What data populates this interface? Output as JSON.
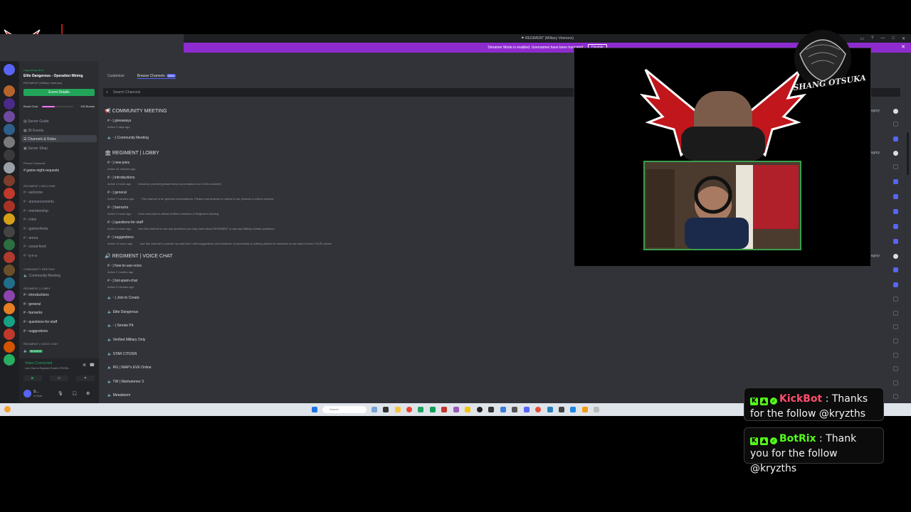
{
  "window": {
    "title": "REGIMENT (Military Veterans)",
    "notice": "Streamer Mode is enabled. Usernames have been truncated.",
    "notice_button": "Disable"
  },
  "server": {
    "happening_now": "Happening Now",
    "event_title": "Elite Dangerous - Operation Mining",
    "event_button": "Event Details",
    "boost_goal": "Boost Goal",
    "boost_count": "109 Boosts",
    "menu": [
      "Server Guide",
      "36 Events",
      "Channels & Roles",
      "Server Shop"
    ],
    "pinned_header": "Pinned Channels",
    "pinned": [
      "game-night-requests"
    ],
    "categories": [
      {
        "name": "REGIMENT | WELCOME",
        "items": [
          "welcome",
          "announcements",
          "membership",
          "roles",
          "games4vets",
          "arena",
          "social-feed",
          "q-n-a"
        ]
      },
      {
        "name": "COMMUNITY MEETING",
        "items": [
          "Community Meeting"
        ]
      },
      {
        "name": "REGIMENT | LOBBY",
        "items": [
          "introductions",
          "general",
          "barracks",
          "questions-for-staff",
          "suggestions"
        ]
      },
      {
        "name": "REGIMENT | VOICE CHAT",
        "items": []
      }
    ],
    "in_voice_label": "IN VOICE"
  },
  "voice_panel": {
    "status": "Video Connected",
    "sub": "Live Chat on Regiment Twitch | REGIM...",
    "user": "S...",
    "user_status": "In Voice"
  },
  "browse": {
    "tab_customize": "Customize",
    "tab_browse": "Browse Channels",
    "tab_new": "NEW",
    "search_placeholder": "Search Channels",
    "category_label": "Category",
    "sections": [
      {
        "name": "COMMUNITY MEETING",
        "channels": [
          {
            "name": "giveaways",
            "activity": "Active 2 days ago",
            "desc": ""
          },
          {
            "name": "Community Meeting",
            "activity": "",
            "desc": ""
          }
        ]
      },
      {
        "name": "REGIMENT | LOBBY",
        "channels": [
          {
            "name": "new-joins",
            "activity": "Active 44 minutes ago",
            "desc": ""
          },
          {
            "name": "introductions",
            "activity": "Active 4 hours ago",
            "desc": "Introduce yourself (please keep conversations out of this channel)"
          },
          {
            "name": "general",
            "activity": "Active 7 minutes ago",
            "desc": "This channel is for general conversations. Please post pictures or videos in our pictures-n-videos channel."
          },
          {
            "name": "barracks",
            "activity": "Active 2 hours ago",
            "desc": "Chat reserved for official verified members of Regiment Gaming"
          },
          {
            "name": "questions-for-staff",
            "activity": "Active 4 hours ago",
            "desc": "Use this channel to ask any questions you may have about REGIMENT or ask any Military related questions"
          },
          {
            "name": "suggestions",
            "activity": "Active 14 hours ago",
            "desc": "Use this channel to provide my staff and I with suggestions and feedback. A community is nothing without its members so we want to hear YOUR voices!"
          }
        ]
      },
      {
        "name": "REGIMENT | VOICE CHAT",
        "channels": [
          {
            "name": "how-to-use-voice",
            "activity": "Active 2 months ago",
            "desc": ""
          },
          {
            "name": "bot-spam-chat",
            "activity": "Active 3 minutes ago",
            "desc": ""
          },
          {
            "name": "Join to Create",
            "activity": "",
            "desc": ""
          },
          {
            "name": "Elite Dangerous",
            "activity": "",
            "desc": ""
          },
          {
            "name": "Smoke Pit",
            "activity": "",
            "desc": ""
          },
          {
            "name": "Verified Military Only",
            "activity": "",
            "desc": ""
          },
          {
            "name": "STAR CITIZEN",
            "activity": "",
            "desc": ""
          },
          {
            "name": "RG | INAP's EVE Online",
            "activity": "",
            "desc": ""
          },
          {
            "name": "TW | Warhammer 3",
            "activity": "",
            "desc": ""
          },
          {
            "name": "Metalstorm",
            "activity": "",
            "desc": ""
          }
        ]
      }
    ]
  },
  "taskbar": {
    "search_placeholder": "Search"
  },
  "overlay": {
    "brand": "SHANG OTSUKA",
    "alerts": [
      {
        "bot": "KickBot",
        "message": "Thanks for the follow @kryzths"
      },
      {
        "bot": "BotRix",
        "message": "Thank you for the follow @kryzths"
      }
    ]
  },
  "colors": {
    "accent": "#5865f2",
    "notice": "#8d2bcf",
    "online": "#23a559",
    "bot_name": "#53fc18",
    "kickbot_name": "#ff4d6d",
    "brand_red": "#c0161c"
  }
}
